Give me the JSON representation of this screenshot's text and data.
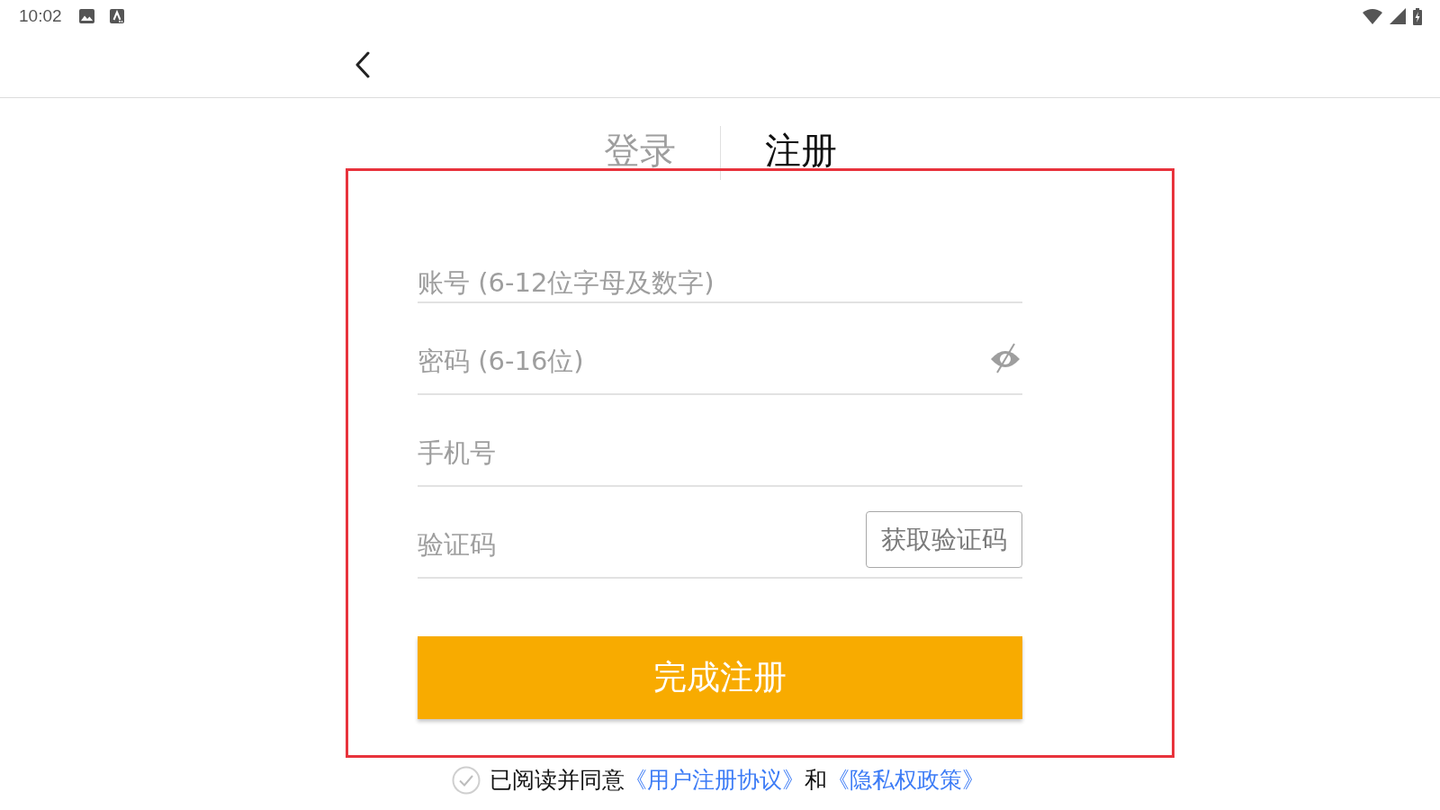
{
  "status_bar": {
    "time": "10:02"
  },
  "tabs": [
    {
      "label": "登录",
      "selected": false
    },
    {
      "label": "注册",
      "selected": true
    }
  ],
  "form": {
    "fields": [
      {
        "kind": "text",
        "placeholder": "账号 (6-12位字母及数字)"
      },
      {
        "kind": "password",
        "placeholder": "密码 (6-16位)",
        "visible": false
      },
      {
        "kind": "phone",
        "placeholder": "手机号"
      },
      {
        "kind": "code",
        "placeholder": "验证码",
        "button": "获取验证码"
      }
    ],
    "submit": "完成注册"
  },
  "agreement": {
    "checked": false,
    "parts": [
      {
        "kind": "text",
        "text": "已阅读并同意"
      },
      {
        "kind": "link",
        "text": "《用户注册协议》"
      },
      {
        "kind": "text",
        "text": "和"
      },
      {
        "kind": "link",
        "text": "《隐私权政策》"
      }
    ]
  }
}
